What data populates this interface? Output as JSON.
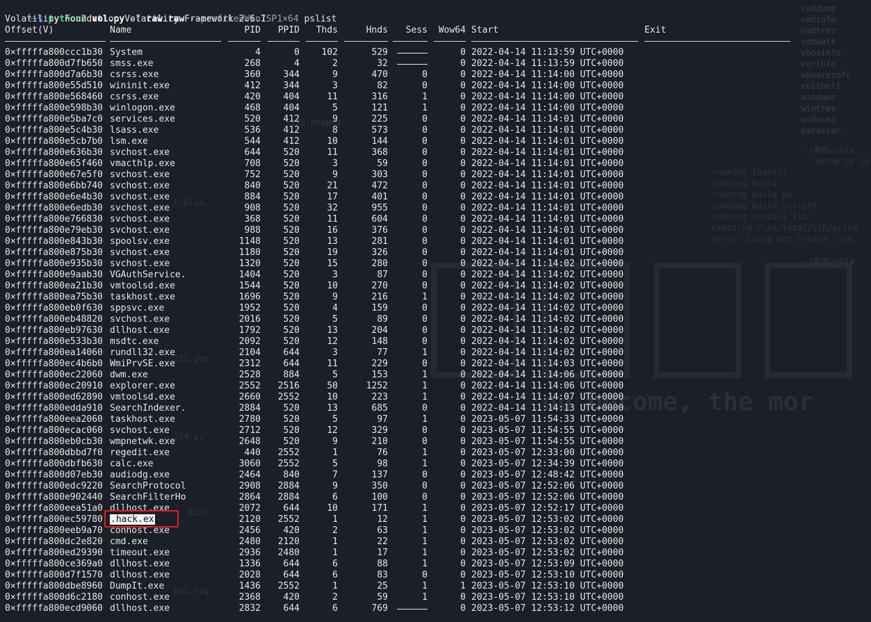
{
  "terminal": {
    "prompt_arrow": "└─$",
    "command": {
      "program": "python2",
      "script": "vol.py",
      "file_flag": "-f",
      "file": "raw.raw",
      "profile_opt": "--profile=Win7SP1×64",
      "plugin": "pslist"
    },
    "banner": "Volatility Foundation Volatility Framework 2.6.1"
  },
  "table": {
    "headers": {
      "offset": "Offset(V)",
      "name": "Name",
      "pid": "PID",
      "ppid": "PPID",
      "thds": "Thds",
      "hnds": "Hnds",
      "sess": "Sess",
      "wow64": "Wow64",
      "start": "Start",
      "exit": "Exit"
    },
    "rows": [
      {
        "offset": "0×fffffa800ccc1b30",
        "name": "System",
        "pid": "4",
        "ppid": "0",
        "thds": "102",
        "hnds": "529",
        "sess": "",
        "wow": "0",
        "start": "2022-04-14 11:13:59 UTC+0000"
      },
      {
        "offset": "0×fffffa800d7fb650",
        "name": "smss.exe",
        "pid": "268",
        "ppid": "4",
        "thds": "2",
        "hnds": "32",
        "sess": "",
        "wow": "0",
        "start": "2022-04-14 11:13:59 UTC+0000"
      },
      {
        "offset": "0×fffffa800d7a6b30",
        "name": "csrss.exe",
        "pid": "360",
        "ppid": "344",
        "thds": "9",
        "hnds": "470",
        "sess": "0",
        "wow": "0",
        "start": "2022-04-14 11:14:00 UTC+0000"
      },
      {
        "offset": "0×fffffa800e55d510",
        "name": "wininit.exe",
        "pid": "412",
        "ppid": "344",
        "thds": "3",
        "hnds": "82",
        "sess": "0",
        "wow": "0",
        "start": "2022-04-14 11:14:00 UTC+0000"
      },
      {
        "offset": "0×fffffa800e568460",
        "name": "csrss.exe",
        "pid": "420",
        "ppid": "404",
        "thds": "11",
        "hnds": "316",
        "sess": "1",
        "wow": "0",
        "start": "2022-04-14 11:14:00 UTC+0000"
      },
      {
        "offset": "0×fffffa800e598b30",
        "name": "winlogon.exe",
        "pid": "468",
        "ppid": "404",
        "thds": "5",
        "hnds": "121",
        "sess": "1",
        "wow": "0",
        "start": "2022-04-14 11:14:00 UTC+0000"
      },
      {
        "offset": "0×fffffa800e5ba7c0",
        "name": "services.exe",
        "pid": "520",
        "ppid": "412",
        "thds": "9",
        "hnds": "225",
        "sess": "0",
        "wow": "0",
        "start": "2022-04-14 11:14:01 UTC+0000"
      },
      {
        "offset": "0×fffffa800e5c4b30",
        "name": "lsass.exe",
        "pid": "536",
        "ppid": "412",
        "thds": "8",
        "hnds": "573",
        "sess": "0",
        "wow": "0",
        "start": "2022-04-14 11:14:01 UTC+0000"
      },
      {
        "offset": "0×fffffa800e5cb7b0",
        "name": "lsm.exe",
        "pid": "544",
        "ppid": "412",
        "thds": "10",
        "hnds": "144",
        "sess": "0",
        "wow": "0",
        "start": "2022-04-14 11:14:01 UTC+0000"
      },
      {
        "offset": "0×fffffa800e636b30",
        "name": "svchost.exe",
        "pid": "644",
        "ppid": "520",
        "thds": "11",
        "hnds": "368",
        "sess": "0",
        "wow": "0",
        "start": "2022-04-14 11:14:01 UTC+0000"
      },
      {
        "offset": "0×fffffa800e65f460",
        "name": "vmacthlp.exe",
        "pid": "708",
        "ppid": "520",
        "thds": "3",
        "hnds": "59",
        "sess": "0",
        "wow": "0",
        "start": "2022-04-14 11:14:01 UTC+0000"
      },
      {
        "offset": "0×fffffa800e67e5f0",
        "name": "svchost.exe",
        "pid": "752",
        "ppid": "520",
        "thds": "9",
        "hnds": "303",
        "sess": "0",
        "wow": "0",
        "start": "2022-04-14 11:14:01 UTC+0000"
      },
      {
        "offset": "0×fffffa800e6bb740",
        "name": "svchost.exe",
        "pid": "840",
        "ppid": "520",
        "thds": "21",
        "hnds": "472",
        "sess": "0",
        "wow": "0",
        "start": "2022-04-14 11:14:01 UTC+0000"
      },
      {
        "offset": "0×fffffa800e6e4b30",
        "name": "svchost.exe",
        "pid": "884",
        "ppid": "520",
        "thds": "17",
        "hnds": "401",
        "sess": "0",
        "wow": "0",
        "start": "2022-04-14 11:14:01 UTC+0000"
      },
      {
        "offset": "0×fffffa800e6edb30",
        "name": "svchost.exe",
        "pid": "908",
        "ppid": "520",
        "thds": "32",
        "hnds": "955",
        "sess": "0",
        "wow": "0",
        "start": "2022-04-14 11:14:01 UTC+0000"
      },
      {
        "offset": "0×fffffa800e766830",
        "name": "svchost.exe",
        "pid": "368",
        "ppid": "520",
        "thds": "11",
        "hnds": "604",
        "sess": "0",
        "wow": "0",
        "start": "2022-04-14 11:14:01 UTC+0000"
      },
      {
        "offset": "0×fffffa800e79eb30",
        "name": "svchost.exe",
        "pid": "988",
        "ppid": "520",
        "thds": "16",
        "hnds": "376",
        "sess": "0",
        "wow": "0",
        "start": "2022-04-14 11:14:01 UTC+0000"
      },
      {
        "offset": "0×fffffa800e843b30",
        "name": "spoolsv.exe",
        "pid": "1148",
        "ppid": "520",
        "thds": "13",
        "hnds": "281",
        "sess": "0",
        "wow": "0",
        "start": "2022-04-14 11:14:01 UTC+0000"
      },
      {
        "offset": "0×fffffa800e875b30",
        "name": "svchost.exe",
        "pid": "1180",
        "ppid": "520",
        "thds": "19",
        "hnds": "326",
        "sess": "0",
        "wow": "0",
        "start": "2022-04-14 11:14:01 UTC+0000"
      },
      {
        "offset": "0×fffffa800e935b30",
        "name": "svchost.exe",
        "pid": "1320",
        "ppid": "520",
        "thds": "15",
        "hnds": "280",
        "sess": "0",
        "wow": "0",
        "start": "2022-04-14 11:14:02 UTC+0000"
      },
      {
        "offset": "0×fffffa800e9aab30",
        "name": "VGAuthService.",
        "pid": "1404",
        "ppid": "520",
        "thds": "3",
        "hnds": "87",
        "sess": "0",
        "wow": "0",
        "start": "2022-04-14 11:14:02 UTC+0000"
      },
      {
        "offset": "0×fffffa800ea21b30",
        "name": "vmtoolsd.exe",
        "pid": "1544",
        "ppid": "520",
        "thds": "10",
        "hnds": "270",
        "sess": "0",
        "wow": "0",
        "start": "2022-04-14 11:14:02 UTC+0000"
      },
      {
        "offset": "0×fffffa800ea75b30",
        "name": "taskhost.exe",
        "pid": "1696",
        "ppid": "520",
        "thds": "9",
        "hnds": "216",
        "sess": "1",
        "wow": "0",
        "start": "2022-04-14 11:14:02 UTC+0000"
      },
      {
        "offset": "0×fffffa800eb0f630",
        "name": "sppsvc.exe",
        "pid": "1952",
        "ppid": "520",
        "thds": "4",
        "hnds": "159",
        "sess": "0",
        "wow": "0",
        "start": "2022-04-14 11:14:02 UTC+0000"
      },
      {
        "offset": "0×fffffa800eb48820",
        "name": "svchost.exe",
        "pid": "2016",
        "ppid": "520",
        "thds": "5",
        "hnds": "89",
        "sess": "0",
        "wow": "0",
        "start": "2022-04-14 11:14:02 UTC+0000"
      },
      {
        "offset": "0×fffffa800eb97630",
        "name": "dllhost.exe",
        "pid": "1792",
        "ppid": "520",
        "thds": "13",
        "hnds": "204",
        "sess": "0",
        "wow": "0",
        "start": "2022-04-14 11:14:02 UTC+0000"
      },
      {
        "offset": "0×fffffa800e533b30",
        "name": "msdtc.exe",
        "pid": "2092",
        "ppid": "520",
        "thds": "12",
        "hnds": "148",
        "sess": "0",
        "wow": "0",
        "start": "2022-04-14 11:14:02 UTC+0000"
      },
      {
        "offset": "0×fffffa800ea14060",
        "name": "rundll32.exe",
        "pid": "2104",
        "ppid": "644",
        "thds": "3",
        "hnds": "77",
        "sess": "1",
        "wow": "0",
        "start": "2022-04-14 11:14:02 UTC+0000"
      },
      {
        "offset": "0×fffffa800ec4b6b0",
        "name": "WmiPrvSE.exe",
        "pid": "2312",
        "ppid": "644",
        "thds": "11",
        "hnds": "229",
        "sess": "0",
        "wow": "0",
        "start": "2022-04-14 11:14:03 UTC+0000"
      },
      {
        "offset": "0×fffffa800ec22060",
        "name": "dwm.exe",
        "pid": "2528",
        "ppid": "884",
        "thds": "5",
        "hnds": "153",
        "sess": "1",
        "wow": "0",
        "start": "2022-04-14 11:14:06 UTC+0000"
      },
      {
        "offset": "0×fffffa800ec20910",
        "name": "explorer.exe",
        "pid": "2552",
        "ppid": "2516",
        "thds": "50",
        "hnds": "1252",
        "sess": "1",
        "wow": "0",
        "start": "2022-04-14 11:14:06 UTC+0000"
      },
      {
        "offset": "0×fffffa800ed62890",
        "name": "vmtoolsd.exe",
        "pid": "2660",
        "ppid": "2552",
        "thds": "10",
        "hnds": "223",
        "sess": "1",
        "wow": "0",
        "start": "2022-04-14 11:14:07 UTC+0000"
      },
      {
        "offset": "0×fffffa800edda910",
        "name": "SearchIndexer.",
        "pid": "2884",
        "ppid": "520",
        "thds": "13",
        "hnds": "685",
        "sess": "0",
        "wow": "0",
        "start": "2022-04-14 11:14:13 UTC+0000"
      },
      {
        "offset": "0×fffffa800eea2060",
        "name": "taskhost.exe",
        "pid": "2780",
        "ppid": "520",
        "thds": "5",
        "hnds": "97",
        "sess": "1",
        "wow": "0",
        "start": "2023-05-07 11:54:33 UTC+0000"
      },
      {
        "offset": "0×fffffa800ecac060",
        "name": "svchost.exe",
        "pid": "2712",
        "ppid": "520",
        "thds": "12",
        "hnds": "329",
        "sess": "0",
        "wow": "0",
        "start": "2023-05-07 11:54:55 UTC+0000"
      },
      {
        "offset": "0×fffffa800eb0cb30",
        "name": "wmpnetwk.exe",
        "pid": "2648",
        "ppid": "520",
        "thds": "9",
        "hnds": "210",
        "sess": "0",
        "wow": "0",
        "start": "2023-05-07 11:54:55 UTC+0000"
      },
      {
        "offset": "0×fffffa800dbbd7f0",
        "name": "regedit.exe",
        "pid": "440",
        "ppid": "2552",
        "thds": "1",
        "hnds": "76",
        "sess": "1",
        "wow": "0",
        "start": "2023-05-07 12:33:00 UTC+0000"
      },
      {
        "offset": "0×fffffa800dbfb630",
        "name": "calc.exe",
        "pid": "3060",
        "ppid": "2552",
        "thds": "5",
        "hnds": "98",
        "sess": "1",
        "wow": "0",
        "start": "2023-05-07 12:34:39 UTC+0000"
      },
      {
        "offset": "0×fffffa800d07eb30",
        "name": "audiodg.exe",
        "pid": "2464",
        "ppid": "840",
        "thds": "7",
        "hnds": "137",
        "sess": "0",
        "wow": "0",
        "start": "2023-05-07 12:48:42 UTC+0000"
      },
      {
        "offset": "0×fffffa800edc9220",
        "name": "SearchProtocol",
        "pid": "2908",
        "ppid": "2884",
        "thds": "9",
        "hnds": "350",
        "sess": "0",
        "wow": "0",
        "start": "2023-05-07 12:52:06 UTC+0000"
      },
      {
        "offset": "0×fffffa800e902440",
        "name": "SearchFilterHo",
        "pid": "2864",
        "ppid": "2884",
        "thds": "6",
        "hnds": "100",
        "sess": "0",
        "wow": "0",
        "start": "2023-05-07 12:52:06 UTC+0000"
      },
      {
        "offset": "0×fffffa800eea51a0",
        "name": "dllhost.exe",
        "pid": "2072",
        "ppid": "644",
        "thds": "10",
        "hnds": "171",
        "sess": "1",
        "wow": "0",
        "start": "2023-05-07 12:52:17 UTC+0000"
      },
      {
        "offset": "0×fffffa800ec59780",
        "name": ".hack.ex",
        "pid": "2120",
        "ppid": "2552",
        "thds": "1",
        "hnds": "12",
        "sess": "1",
        "wow": "0",
        "start": "2023-05-07 12:53:02 UTC+0000",
        "highlight": true
      },
      {
        "offset": "0×fffffa800eeb9a70",
        "name": "conhost.exe",
        "pid": "2456",
        "ppid": "420",
        "thds": "2",
        "hnds": "63",
        "sess": "1",
        "wow": "0",
        "start": "2023-05-07 12:53:02 UTC+0000"
      },
      {
        "offset": "0×fffffa800dc2e820",
        "name": "cmd.exe",
        "pid": "2480",
        "ppid": "2120",
        "thds": "1",
        "hnds": "22",
        "sess": "1",
        "wow": "0",
        "start": "2023-05-07 12:53:02 UTC+0000"
      },
      {
        "offset": "0×fffffa800ed29390",
        "name": "timeout.exe",
        "pid": "2936",
        "ppid": "2480",
        "thds": "1",
        "hnds": "17",
        "sess": "1",
        "wow": "0",
        "start": "2023-05-07 12:53:02 UTC+0000"
      },
      {
        "offset": "0×fffffa800ce369a0",
        "name": "dllhost.exe",
        "pid": "1336",
        "ppid": "644",
        "thds": "6",
        "hnds": "88",
        "sess": "1",
        "wow": "0",
        "start": "2023-05-07 12:53:09 UTC+0000"
      },
      {
        "offset": "0×fffffa800d7f1570",
        "name": "dllhost.exe",
        "pid": "2028",
        "ppid": "644",
        "thds": "6",
        "hnds": "83",
        "sess": "0",
        "wow": "0",
        "start": "2023-05-07 12:53:10 UTC+0000"
      },
      {
        "offset": "0×fffffa800dbe8960",
        "name": "DumpIt.exe",
        "pid": "1436",
        "ppid": "2552",
        "thds": "1",
        "hnds": "25",
        "sess": "1",
        "wow": "1",
        "start": "2023-05-07 12:53:10 UTC+0000"
      },
      {
        "offset": "0×fffffa800d6c2180",
        "name": "conhost.exe",
        "pid": "2368",
        "ppid": "420",
        "thds": "2",
        "hnds": "59",
        "sess": "1",
        "wow": "0",
        "start": "2023-05-07 12:53:10 UTC+0000"
      },
      {
        "offset": "0×fffffa800ecd9060",
        "name": "dllhost.exe",
        "pid": "2832",
        "ppid": "644",
        "thds": "6",
        "hnds": "769",
        "sess": "",
        "wow": "0",
        "start": "2023-05-07 12:53:12 UTC+0000"
      }
    ]
  },
  "background": {
    "right_list": [
      "vaddump",
      "vadinfo",
      "vadtree",
      "vadwalk",
      "vboxinfo",
      "verinfo",
      "vmwareinfo",
      "volshell",
      "windows",
      "wintree",
      "wndscan",
      "yarascan"
    ],
    "install_lines": [
      "setup.py install",
      "running install",
      "running build",
      "running build_py",
      "running build_scripts",
      "running install_lib",
      "creating /usr/local/lib/pytho",
      "error: could not create '/us"
    ],
    "path_fragment_1": "~/桌面/vola",
    "path_fragment_2": "~/桌面/vola",
    "quote_fragment": "ou become, the mor",
    "desktop_labels": [
      "222.pngpng",
      "C-Blue...",
      "222.php",
      "234.py",
      "8233",
      "poc.svg"
    ]
  }
}
